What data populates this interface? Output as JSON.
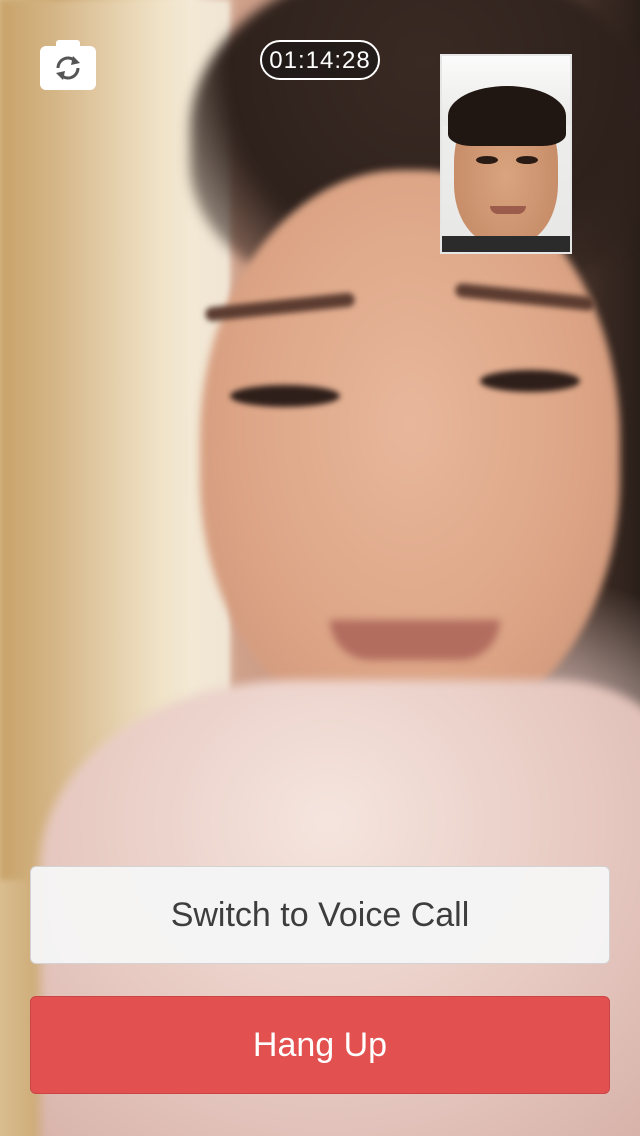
{
  "call": {
    "timer": "01:14:28"
  },
  "controls": {
    "camera_switch_icon": "camera-switch-icon",
    "switch_voice_label": "Switch to Voice Call",
    "hang_up_label": "Hang Up"
  },
  "colors": {
    "hang_up": "#e35050",
    "voice_button": "#f5f5f5",
    "timer_border": "#ffffff"
  }
}
